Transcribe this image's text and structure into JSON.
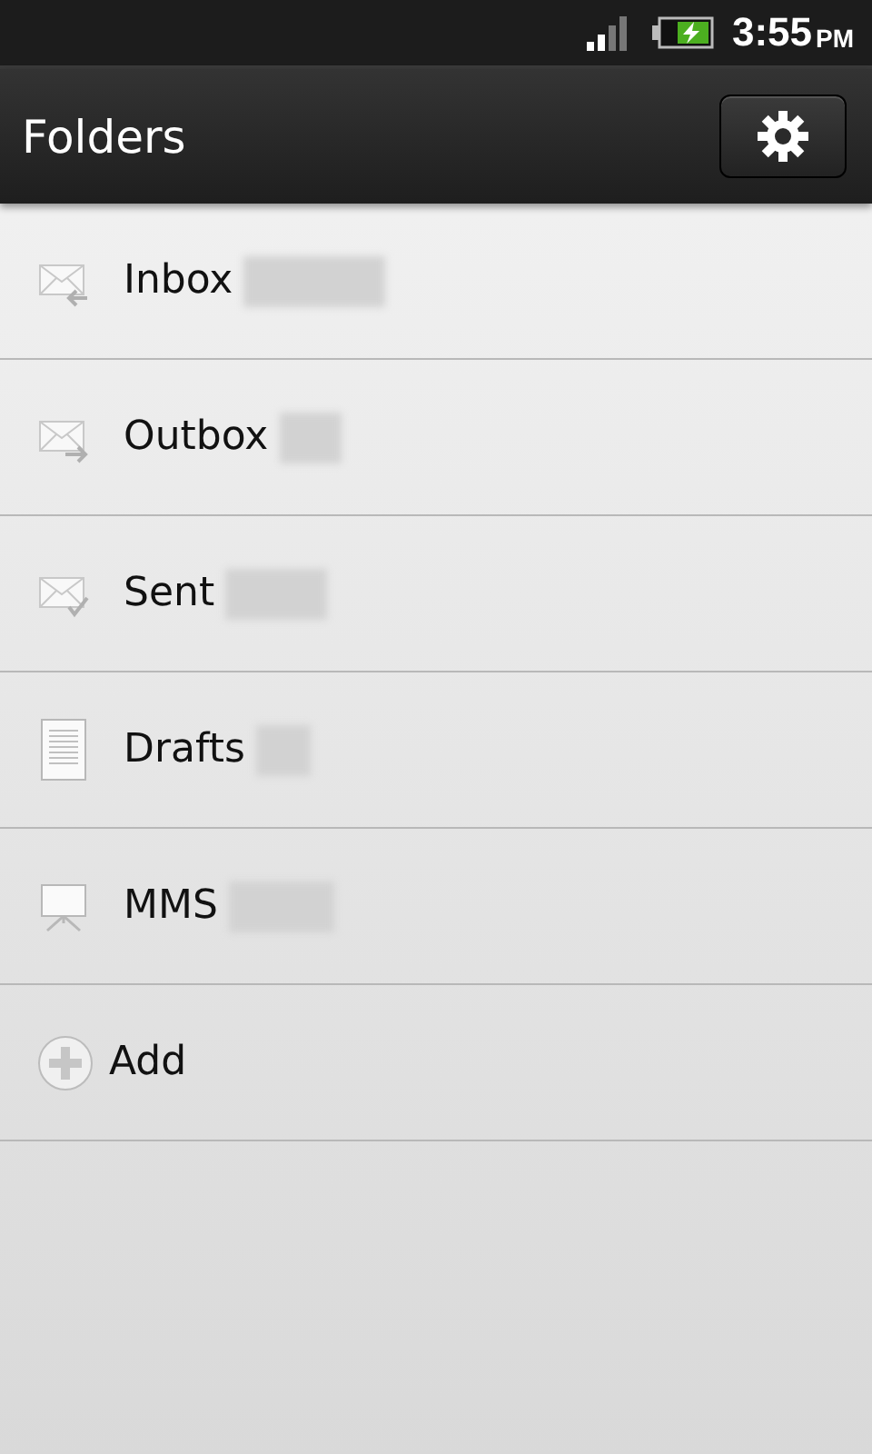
{
  "status_bar": {
    "time": "3:55",
    "meridiem": "PM",
    "battery_charging": true
  },
  "header": {
    "title": "Folders"
  },
  "folders": [
    {
      "kind": "inbox",
      "label": "Inbox",
      "redacted": true
    },
    {
      "kind": "outbox",
      "label": "Outbox",
      "redacted": true
    },
    {
      "kind": "sent",
      "label": "Sent",
      "redacted": true
    },
    {
      "kind": "drafts",
      "label": "Drafts",
      "redacted": true
    },
    {
      "kind": "mms",
      "label": "MMS",
      "redacted": true
    },
    {
      "kind": "add",
      "label": "Add",
      "redacted": false
    }
  ]
}
